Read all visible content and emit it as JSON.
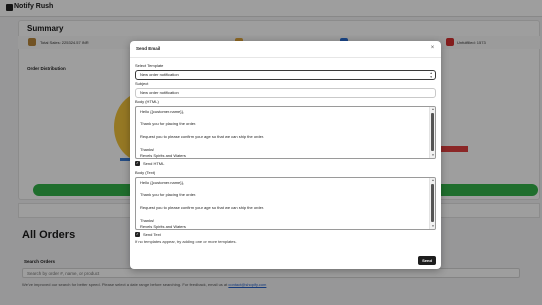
{
  "app": {
    "title": "Notify Rush"
  },
  "summary": {
    "title": "Summary",
    "stats": [
      {
        "text": "Total Sales: 225324.57 INR",
        "icon": "money-bag-icon",
        "color": "#b8863b"
      },
      {
        "text": "",
        "icon": "stat-icon",
        "color": "#e0a63a"
      },
      {
        "text": "",
        "icon": "stat-icon",
        "color": "#2b6fd6"
      },
      {
        "text": "Unfulfilled: 1573",
        "icon": "box-icon",
        "color": "#d33030"
      }
    ],
    "distribution_title": "Order Distribution"
  },
  "orders": {
    "title": "All Orders",
    "search_label": "Search Orders",
    "search_placeholder": "Search by order #, name, or product",
    "notice": "We've improved our search for better speed. Please select a date range before searching. For feedback, email us at",
    "notice_email": "contact@shopify.com"
  },
  "modal": {
    "title": "Send Email",
    "close_glyph": "×",
    "select_label": "Select Template",
    "select_value": "New order notification",
    "subject_label": "Subject",
    "subject_value": "New order notification",
    "body_html_label": "Body (HTML)",
    "body_html_lines": [
      "Hello {{customer.name}},",
      "Thank you for placing the order.",
      "Request you to please confirm your age so that we can ship the order.",
      "Thanks!",
      "Revels Spirits and Waters"
    ],
    "send_html_label": "Send HTML",
    "body_text_label": "Body (Text)",
    "body_text_lines": [
      "Hello {{customer.name}},",
      "Thank you for placing the order.",
      "Request you to please confirm your age so that we can ship the order.",
      "Thanks!",
      "Revels Spirits and Waters"
    ],
    "send_text_label": "Send Text",
    "hint": "If no templates appear, try adding one or more templates.",
    "send_button": "Send"
  }
}
